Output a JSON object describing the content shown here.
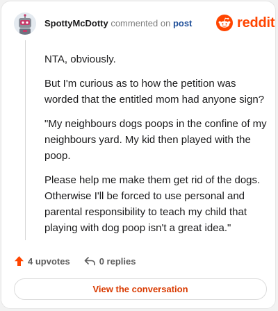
{
  "header": {
    "author": "SpottyMcDotty",
    "action_text": " commented on ",
    "post_link": "post",
    "brand": "reddit"
  },
  "comment": {
    "paragraphs": [
      "NTA, obviously.",
      "But I'm curious as to how the petition was worded that the entitled mom had anyone sign?",
      "\"My neighbours dogs poops in the confine of my neighbours yard. My kid then played with the poop.",
      "Please help me make them get rid of the dogs. Otherwise I'll be forced to use personal and parental responsibility to teach my child that playing with dog poop isn't a great idea.\""
    ]
  },
  "actions": {
    "upvotes": "4 upvotes",
    "replies": "0 replies"
  },
  "footer": {
    "button_label": "View the conversation"
  },
  "colors": {
    "brand": "#ff4500",
    "link": "#1f4f99",
    "button_text": "#d93a00"
  },
  "icons": {
    "avatar": "robot-avatar",
    "logo": "reddit-snoo-icon",
    "upvote": "upvote-arrow-icon",
    "reply": "reply-arrow-icon"
  }
}
